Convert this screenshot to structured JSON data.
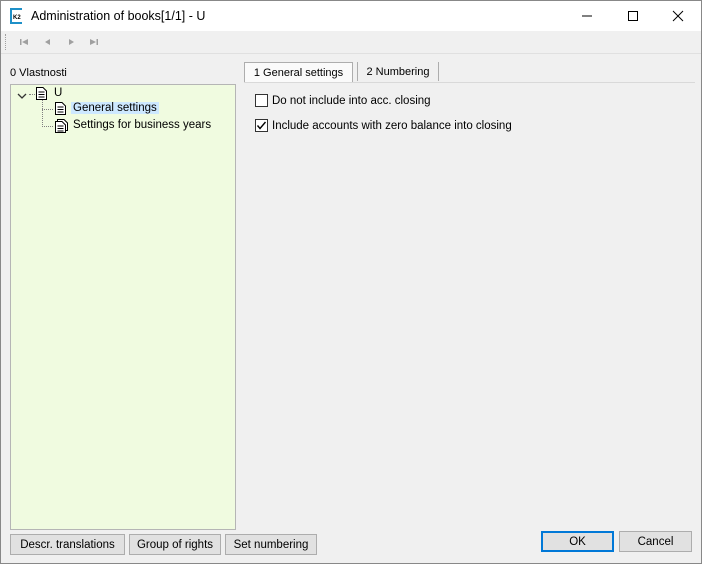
{
  "window": {
    "title": "Administration of books[1/1] - U",
    "app_icon_text": "K2",
    "minimize_icon": "minimize-icon",
    "maximize_icon": "maximize-icon",
    "close_icon": "close-icon"
  },
  "toolbar": {
    "icons": [
      "first-record-icon",
      "previous-record-icon",
      "next-record-icon",
      "last-record-icon"
    ]
  },
  "left_panel": {
    "label": "0 Vlastnosti",
    "tree": {
      "root": "U",
      "children": [
        "General settings",
        "Settings for business years"
      ],
      "selected": "General settings"
    }
  },
  "tabs": [
    {
      "label": "1 General settings",
      "active": true
    },
    {
      "label": "2 Numbering",
      "active": false
    }
  ],
  "settings": {
    "options": [
      {
        "label": "Do not include into acc. closing",
        "checked": false
      },
      {
        "label": "Include accounts with zero balance into closing",
        "checked": true
      }
    ]
  },
  "footer": {
    "descr_translations": "Descr. translations",
    "group_of_rights": "Group of rights",
    "set_numbering": "Set numbering",
    "ok": "OK",
    "cancel": "Cancel"
  },
  "colors": {
    "tree_background": "#f0fbe0",
    "selection": "#cde8ff",
    "default_button_border": "#0078d7"
  }
}
